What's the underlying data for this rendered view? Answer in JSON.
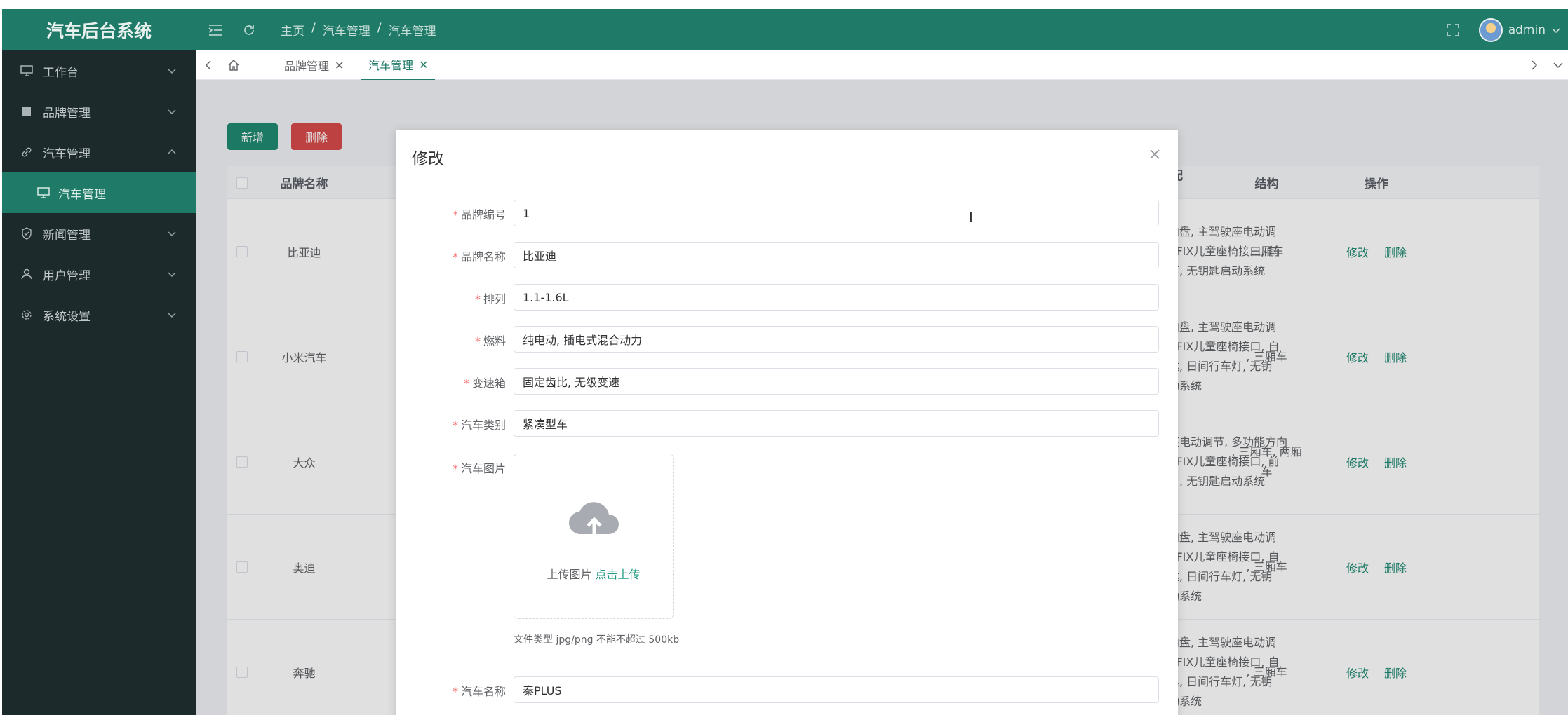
{
  "app": {
    "title": "汽车后台系统"
  },
  "header": {
    "breadcrumb": [
      "主页",
      "汽车管理",
      "汽车管理"
    ],
    "user": "admin"
  },
  "sidebar": {
    "items": [
      {
        "label": "工作台",
        "icon": "monitor-icon"
      },
      {
        "label": "品牌管理",
        "icon": "document-icon"
      },
      {
        "label": "汽车管理",
        "icon": "link-icon",
        "expanded": true
      },
      {
        "label": "新闻管理",
        "icon": "shield-icon"
      },
      {
        "label": "用户管理",
        "icon": "user-icon"
      },
      {
        "label": "系统设置",
        "icon": "gear-icon"
      }
    ],
    "sub_item": "汽车管理"
  },
  "tabs": [
    {
      "label": "品牌管理",
      "active": false
    },
    {
      "label": "汽车管理",
      "active": true
    }
  ],
  "toolbar": {
    "add_label": "新增",
    "delete_label": "删除"
  },
  "table": {
    "headers": {
      "brand": "品牌名称",
      "config": "全配置",
      "structure": "结构",
      "ops": "操作"
    },
    "rows": [
      {
        "brand": "比亚迪",
        "config": [
          "方向盘, 主驾驶座电动调",
          "ISOFIX儿童座椅接口, 前",
          "车灯, 无钥匙启动系统"
        ],
        "structure": "三厢车"
      },
      {
        "brand": "小米汽车",
        "config": [
          "方向盘, 主驾驶座电动调",
          "ISOFIX儿童座椅接口, 自",
          "雷达, 日间行车灯, 无钥",
          "启动系统"
        ],
        "structure": ", 三厢车"
      },
      {
        "brand": "大众",
        "config": [
          "驶座电动调节, 多功能方向",
          "ISOFIX儿童座椅接口, 前",
          "车灯, 无钥匙启动系统"
        ],
        "structure_lines": [
          ", 三厢车, 两厢",
          "车"
        ]
      },
      {
        "brand": "奥迪",
        "config": [
          "方向盘, 主驾驶座电动调",
          "ISOFIX儿童座椅接口, 自",
          "雷达, 日间行车灯, 无钥",
          "启动系统"
        ],
        "structure": ", 三厢车"
      },
      {
        "brand": "奔驰",
        "config": [
          "方向盘, 主驾驶座电动调",
          "ISOFIX儿童座椅接口, 自",
          "雷达, 日间行车灯, 无钥",
          "启动系统"
        ],
        "structure": ", 三厢车"
      }
    ],
    "edit_label": "修改",
    "delete_label": "删除"
  },
  "dialog": {
    "title": "修改",
    "fields": [
      {
        "label": "品牌编号",
        "value": "1"
      },
      {
        "label": "品牌名称",
        "value": "比亚迪"
      },
      {
        "label": "排列",
        "value": "1.1-1.6L"
      },
      {
        "label": "燃料",
        "value": "纯电动, 插电式混合动力"
      },
      {
        "label": "变速箱",
        "value": "固定齿比, 无级变速"
      },
      {
        "label": "汽车类别",
        "value": "紧凑型车"
      }
    ],
    "image_label": "汽车图片",
    "upload_text": "上传图片",
    "upload_link": "点击上传",
    "upload_hint": "文件类型 jpg/png 不能不超过 500kb",
    "name_label": "汽车名称",
    "name_value": "秦PLUS"
  }
}
